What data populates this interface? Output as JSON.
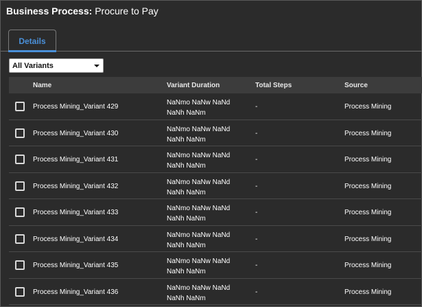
{
  "header": {
    "label": "Business Process:",
    "value": "Procure to Pay"
  },
  "tabs": [
    {
      "label": "Details",
      "active": true
    }
  ],
  "filter": {
    "selected": "All Variants"
  },
  "table": {
    "columns": {
      "name": "Name",
      "duration": "Variant Duration",
      "steps": "Total Steps",
      "source": "Source"
    },
    "rows": [
      {
        "name": "Process Mining_Variant 429",
        "duration": "NaNmo NaNw NaNd NaNh NaNm",
        "steps": "-",
        "source": "Process Mining"
      },
      {
        "name": "Process Mining_Variant 430",
        "duration": "NaNmo NaNw NaNd NaNh NaNm",
        "steps": "-",
        "source": "Process Mining"
      },
      {
        "name": "Process Mining_Variant 431",
        "duration": "NaNmo NaNw NaNd NaNh NaNm",
        "steps": "-",
        "source": "Process Mining"
      },
      {
        "name": "Process Mining_Variant 432",
        "duration": "NaNmo NaNw NaNd NaNh NaNm",
        "steps": "-",
        "source": "Process Mining"
      },
      {
        "name": "Process Mining_Variant 433",
        "duration": "NaNmo NaNw NaNd NaNh NaNm",
        "steps": "-",
        "source": "Process Mining"
      },
      {
        "name": "Process Mining_Variant 434",
        "duration": "NaNmo NaNw NaNd NaNh NaNm",
        "steps": "-",
        "source": "Process Mining"
      },
      {
        "name": "Process Mining_Variant 435",
        "duration": "NaNmo NaNw NaNd NaNh NaNm",
        "steps": "-",
        "source": "Process Mining"
      },
      {
        "name": "Process Mining_Variant 436",
        "duration": "NaNmo NaNw NaNd NaNh NaNm",
        "steps": "-",
        "source": "Process Mining"
      }
    ]
  },
  "colors": {
    "accent": "#4a90d9",
    "background": "#2b2b2b",
    "header_row": "#3c3c3c"
  }
}
